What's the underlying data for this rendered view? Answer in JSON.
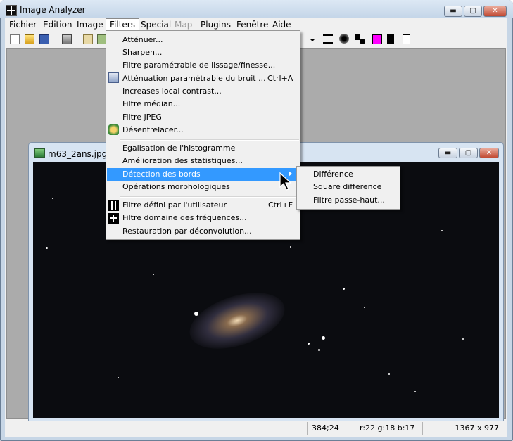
{
  "window": {
    "title": "Image Analyzer",
    "min": "▬",
    "max": "▢",
    "close": "✕"
  },
  "menubar": [
    "Fichier",
    "Edition",
    "Image",
    "Filters",
    "Special",
    "Map",
    "Plugins",
    "Fenêtre",
    "Aide"
  ],
  "toolbar": {
    "tools": [
      "new-file-icon",
      "open-folder-icon",
      "save-icon",
      "print-preview-icon",
      "copy-icon",
      "paste-icon"
    ],
    "right_tools": [
      "line-width-icon",
      "soft-brush-icon",
      "shapes-icon",
      "foreground-color-icon",
      "background-color-icon",
      "outline-square-icon"
    ],
    "colors": {
      "magenta": "#ff00ff",
      "black": "#000000",
      "white": "#ffffff"
    }
  },
  "filters_menu": {
    "items": [
      {
        "label": "Atténuer...",
        "shortcut": ""
      },
      {
        "label": "Sharpen...",
        "shortcut": ""
      },
      {
        "label": "Filtre paramétrable de lissage/finesse...",
        "shortcut": ""
      },
      {
        "label": "Atténuation paramétrable du bruit ...",
        "shortcut": "Ctrl+A"
      },
      {
        "label": "Increases local contrast...",
        "shortcut": ""
      },
      {
        "label": "Filtre médian...",
        "shortcut": ""
      },
      {
        "label": "Filtre JPEG",
        "shortcut": ""
      },
      {
        "label": "Désentrelacer...",
        "shortcut": ""
      },
      {
        "label": "Egalisation de l'histogramme",
        "shortcut": ""
      },
      {
        "label": "Amélioration des statistiques...",
        "shortcut": ""
      },
      {
        "label": "Détection des bords",
        "shortcut": ""
      },
      {
        "label": "Opérations morphologiques",
        "shortcut": ""
      },
      {
        "label": "Filtre défini par l'utilisateur",
        "shortcut": "Ctrl+F"
      },
      {
        "label": "Filtre domaine des fréquences...",
        "shortcut": ""
      },
      {
        "label": "Restauration par déconvolution...",
        "shortcut": ""
      }
    ],
    "highlighted": "Détection des bords"
  },
  "submenu": {
    "items": [
      "Différence",
      "Square difference",
      "Filtre passe-haut..."
    ]
  },
  "child_window": {
    "title": "m63_2ans.jpg [1",
    "min": "▬",
    "max": "▢",
    "close": "✕"
  },
  "status": {
    "coords": "384;24",
    "rgb": "r:22 g:18 b:17",
    "size": "1367 x 977"
  },
  "colors": {
    "highlight": "#3399ff",
    "menu_bg": "#f0f0f0"
  }
}
